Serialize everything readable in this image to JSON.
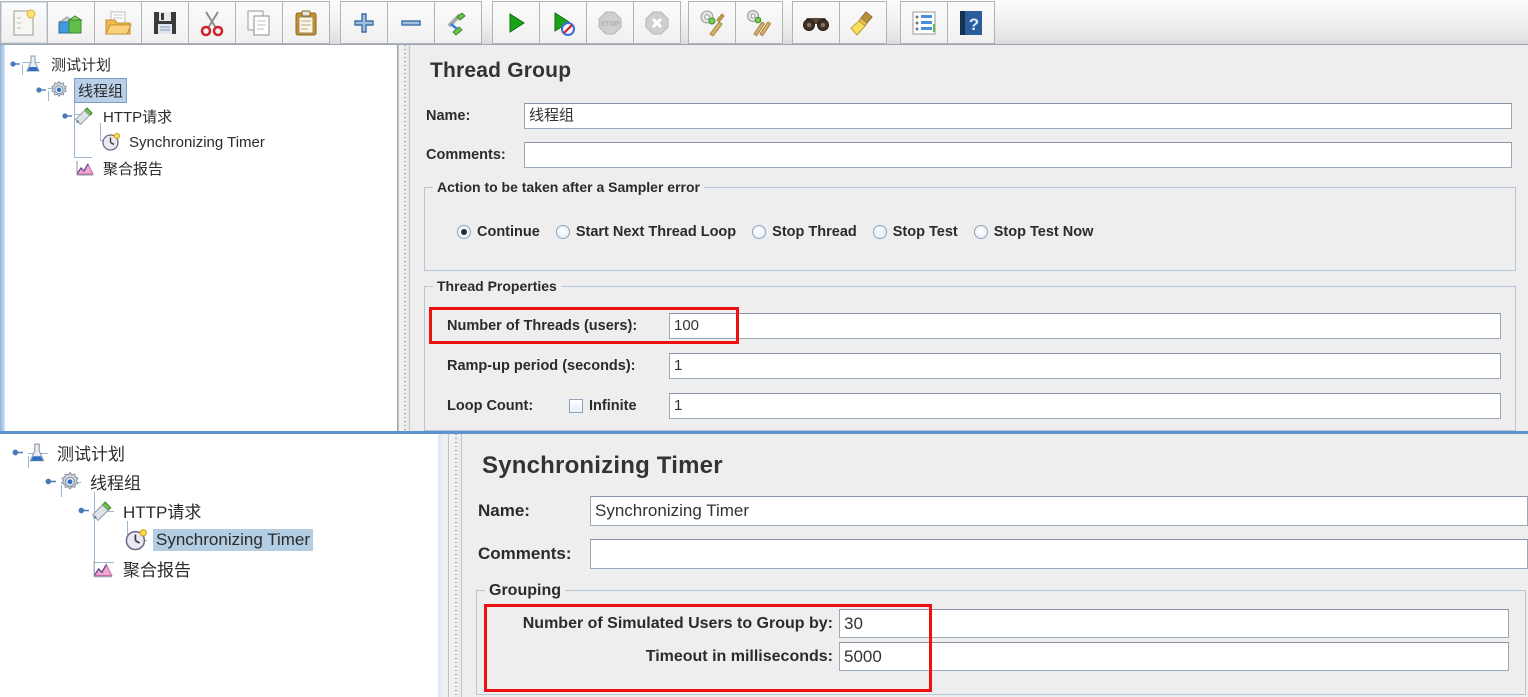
{
  "toolbar": {
    "buttons": [
      {
        "name": "new-icon",
        "tip": "New"
      },
      {
        "name": "templates-icon",
        "tip": "Templates"
      },
      {
        "name": "open-icon",
        "tip": "Open"
      },
      {
        "name": "save-icon",
        "tip": "Save Test Plan"
      },
      {
        "name": "cut-icon",
        "tip": "Cut"
      },
      {
        "name": "copy-icon",
        "tip": "Copy"
      },
      {
        "name": "paste-icon",
        "tip": "Paste"
      },
      {
        "name": "expand-all-icon",
        "tip": "Expand All"
      },
      {
        "name": "collapse-all-icon",
        "tip": "Collapse All"
      },
      {
        "name": "toggle-icon",
        "tip": "Toggle"
      },
      {
        "name": "start-icon",
        "tip": "Start"
      },
      {
        "name": "start-no-pauses-icon",
        "tip": "Start no pauses"
      },
      {
        "name": "stop-icon",
        "tip": "Stop"
      },
      {
        "name": "shutdown-icon",
        "tip": "Shutdown"
      },
      {
        "name": "clear-icon",
        "tip": "Clear"
      },
      {
        "name": "clear-all-icon",
        "tip": "Clear All"
      },
      {
        "name": "search-icon",
        "tip": "Search"
      },
      {
        "name": "reset-search-icon",
        "tip": "Reset Search"
      },
      {
        "name": "function-helper-icon",
        "tip": "Function Helper Dialog"
      },
      {
        "name": "help-icon",
        "tip": "Help"
      }
    ]
  },
  "tree_top": {
    "nodes": [
      {
        "label": "测试计划",
        "icon": "test-plan-icon",
        "selected": false,
        "depth": 0
      },
      {
        "label": "线程组",
        "icon": "thread-group-icon",
        "selected": true,
        "depth": 1
      },
      {
        "label": "HTTP请求",
        "icon": "http-request-icon",
        "selected": false,
        "depth": 2
      },
      {
        "label": "Synchronizing Timer",
        "icon": "timer-icon",
        "selected": false,
        "depth": 3
      },
      {
        "label": "聚合报告",
        "icon": "aggregate-report-icon",
        "selected": false,
        "depth": 2
      }
    ]
  },
  "tree_bottom": {
    "nodes": [
      {
        "label": "测试计划",
        "icon": "test-plan-icon",
        "selected": false,
        "depth": 0
      },
      {
        "label": "线程组",
        "icon": "thread-group-icon",
        "selected": false,
        "depth": 1
      },
      {
        "label": "HTTP请求",
        "icon": "http-request-icon",
        "selected": false,
        "depth": 2
      },
      {
        "label": "Synchronizing Timer",
        "icon": "timer-icon",
        "selected": true,
        "depth": 3
      },
      {
        "label": "聚合报告",
        "icon": "aggregate-report-icon",
        "selected": false,
        "depth": 2
      }
    ]
  },
  "thread_group": {
    "title": "Thread Group",
    "name_label": "Name:",
    "name_value": "线程组",
    "comments_label": "Comments:",
    "comments_value": "",
    "sampler_error": {
      "legend": "Action to be taken after a Sampler error",
      "options": [
        {
          "label": "Continue",
          "selected": true
        },
        {
          "label": "Start Next Thread Loop",
          "selected": false
        },
        {
          "label": "Stop Thread",
          "selected": false
        },
        {
          "label": "Stop Test",
          "selected": false
        },
        {
          "label": "Stop Test Now",
          "selected": false
        }
      ]
    },
    "thread_properties": {
      "legend": "Thread Properties",
      "threads_label": "Number of Threads (users):",
      "threads_value": "100",
      "rampup_label": "Ramp-up period (seconds):",
      "rampup_value": "1",
      "loop_label": "Loop Count:",
      "infinite_label": "Infinite",
      "infinite_checked": false,
      "loop_value": "1"
    }
  },
  "sync_timer": {
    "title": "Synchronizing Timer",
    "name_label": "Name:",
    "name_value": "Synchronizing Timer",
    "comments_label": "Comments:",
    "comments_value": "",
    "grouping": {
      "legend": "Grouping",
      "users_label": "Number of Simulated Users to Group by:",
      "users_value": "30",
      "timeout_label": "Timeout in milliseconds:",
      "timeout_value": "5000"
    }
  },
  "annotations": {
    "highlight_color": "#ee1111",
    "boxes": [
      {
        "name": "number-of-threads-highlight"
      },
      {
        "name": "grouping-fields-highlight"
      }
    ]
  }
}
